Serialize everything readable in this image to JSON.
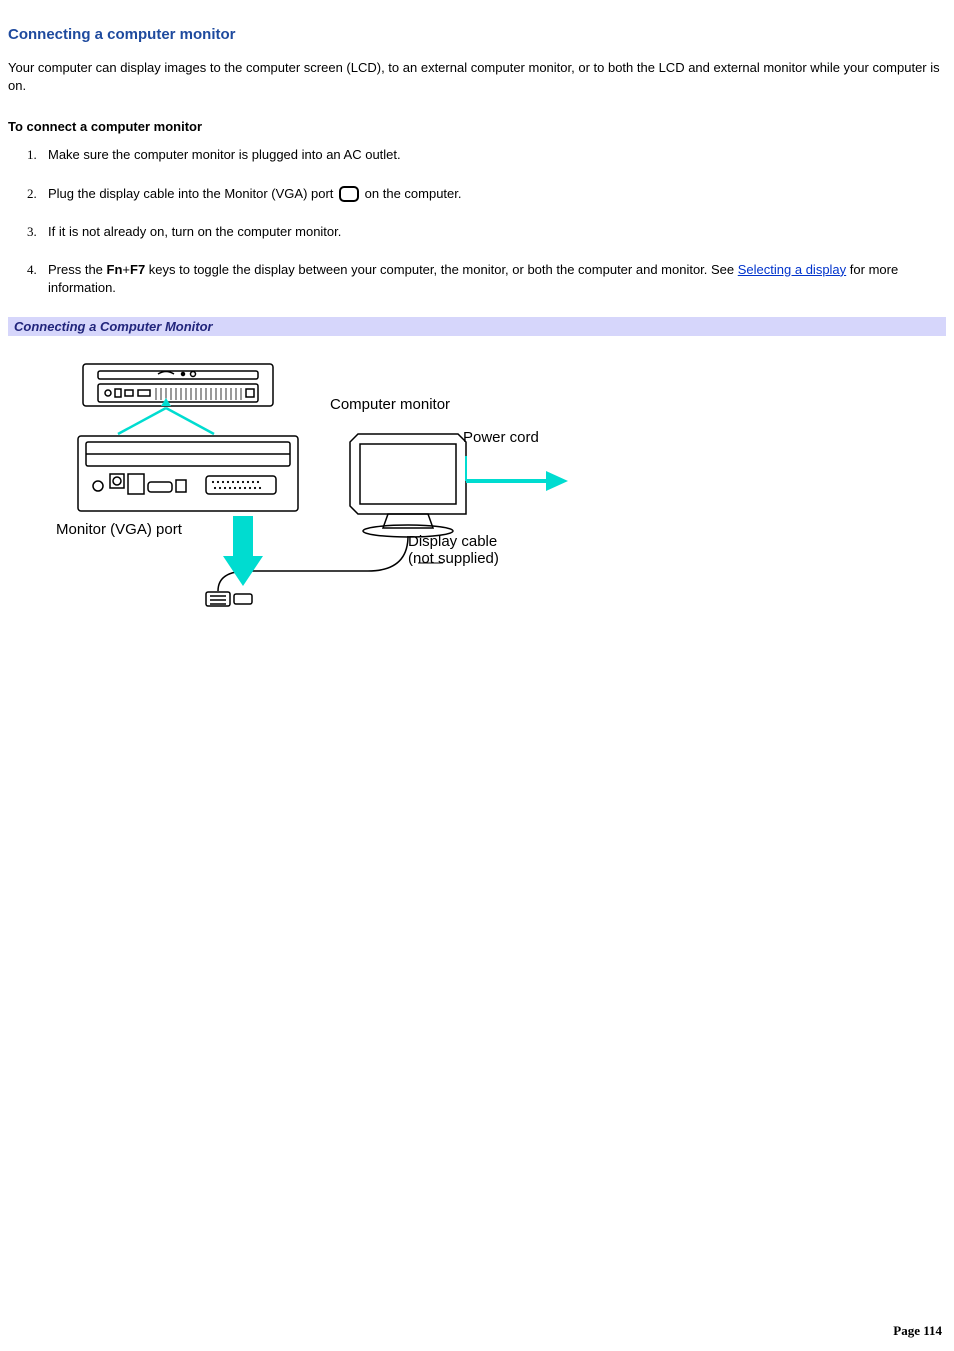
{
  "heading": "Connecting a computer monitor",
  "intro": "Your computer can display images to the computer screen (LCD), to an external computer monitor, or to both the LCD and external monitor while your computer is on.",
  "subheading": "To connect a computer monitor",
  "steps": {
    "s1": "Make sure the computer monitor is plugged into an AC outlet.",
    "s2a": "Plug the display cable into the Monitor (VGA) port ",
    "s2b": " on the computer.",
    "s3": "If it is not already on, turn on the computer monitor.",
    "s4a": "Press the ",
    "s4key1": "Fn",
    "s4plus": "+",
    "s4key2": "F7",
    "s4b": " keys to toggle the display between your computer, the monitor, or both the computer and monitor. See ",
    "s4link": "Selecting a display",
    "s4c": " for more information."
  },
  "caption": "Connecting a Computer Monitor",
  "diagram": {
    "computer_monitor": "Computer monitor",
    "power_cord": "Power cord",
    "vga_port": "Monitor (VGA) port",
    "display_cable1": "Display cable",
    "display_cable2": "(not supplied)"
  },
  "footer": "Page 114"
}
